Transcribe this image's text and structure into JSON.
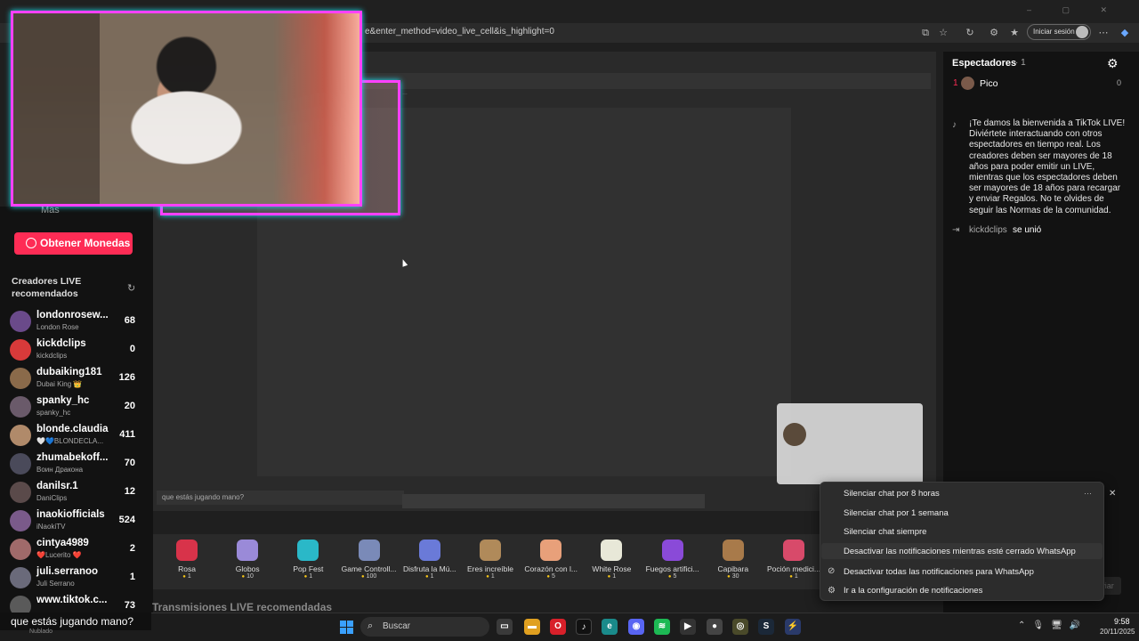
{
  "browser": {
    "url": "e&enter_method=video_live_cell&is_highlight=0",
    "login_label": "Iniciar sesión"
  },
  "sidebar": {
    "more_label": "Más",
    "coins_button": "Obtener Monedas",
    "recommended_title": "Creadores LIVE recomendados",
    "creators": [
      {
        "name": "londonrosew...",
        "sub": "London Rose",
        "count": "68",
        "color": "#6a4a8a"
      },
      {
        "name": "kickdclips",
        "sub": "kickdclips",
        "count": "0",
        "color": "#d83a3a"
      },
      {
        "name": "dubaiking181",
        "sub": "Dubai King 👑",
        "count": "126",
        "color": "#8a6a4a"
      },
      {
        "name": "spanky_hc",
        "sub": "spanky_hc",
        "count": "20",
        "color": "#6a5a6a"
      },
      {
        "name": "blonde.claudia",
        "sub": "🤍💙BLONDECLA...",
        "count": "411",
        "color": "#b08a6a"
      },
      {
        "name": "zhumabekoff...",
        "sub": "Воин Дракона",
        "count": "70",
        "color": "#4a4a5a"
      },
      {
        "name": "danilsr.1",
        "sub": "DaniClips",
        "count": "12",
        "color": "#5a4a4a"
      },
      {
        "name": "inaokiofficials",
        "sub": "iNaokiTV",
        "count": "524",
        "color": "#7a5a8a"
      },
      {
        "name": "cintya4989",
        "sub": "❤️Lucerito ❤️",
        "count": "2",
        "color": "#a06a6a"
      },
      {
        "name": "juli.serranoo",
        "sub": "Juli Serrano",
        "count": "1",
        "color": "#6a6a7a"
      },
      {
        "name": "www.tiktok.c...",
        "sub": "",
        "count": "73",
        "color": "#5a5a5a"
      }
    ],
    "more_streams": "Transmisiones LIVE recomendadas"
  },
  "video": {
    "small_chat_text": "que estás jugando mano?",
    "gifts": [
      {
        "name": "Rosa",
        "price": "1",
        "color": "#d8334a"
      },
      {
        "name": "Globos",
        "price": "10",
        "color": "#9a8ad8"
      },
      {
        "name": "Pop Fest",
        "price": "1",
        "color": "#2ab8c8"
      },
      {
        "name": "Game Controll...",
        "price": "100",
        "color": "#7a8ab8"
      },
      {
        "name": "Disfruta la Mú...",
        "price": "1",
        "color": "#6a7ad8"
      },
      {
        "name": "Eres increíble",
        "price": "1",
        "color": "#b08a5a"
      },
      {
        "name": "Corazón con l...",
        "price": "5",
        "color": "#e8a07a"
      },
      {
        "name": "White Rose",
        "price": "1",
        "color": "#e8e8d8"
      },
      {
        "name": "Fuegos artifici...",
        "price": "5",
        "color": "#8a4ad8"
      },
      {
        "name": "Capibara",
        "price": "30",
        "color": "#a87a4a"
      },
      {
        "name": "Poción medici...",
        "price": "1",
        "color": "#d84a6a"
      }
    ]
  },
  "right": {
    "viewers_label": "Espectadores",
    "viewers_count": "· 1",
    "top_rank": "1",
    "top_name": "Pico",
    "top_score": "0",
    "welcome_text": "¡Te damos la bienvenida a TikTok LIVE! Diviértete interactuando con otros espectadores en tiempo real. Los creadores deben ser mayores de 18 años para poder emitir un LIVE, mientras que los espectadores deben ser mayores de 18 años para recargar y enviar Regalos. No te olvides de seguir las Normas de la comunidad.",
    "joined_user": "kickdclips",
    "joined_text": "se unió",
    "send_label": "Enviar"
  },
  "context_menu": {
    "items": [
      "Silenciar chat por 8 horas",
      "Silenciar chat por 1 semana",
      "Silenciar chat siempre",
      "Desactivar las notificaciones mientras esté cerrado WhatsApp",
      "Desactivar todas las notificaciones para WhatsApp",
      "Ir a la configuración de notificaciones"
    ]
  },
  "overlay": {
    "chat_text": "que estás jugando mano?",
    "weather": "Nublado"
  },
  "taskbar": {
    "search_placeholder": "Buscar",
    "time": "9:58",
    "date": "20/11/2025"
  }
}
